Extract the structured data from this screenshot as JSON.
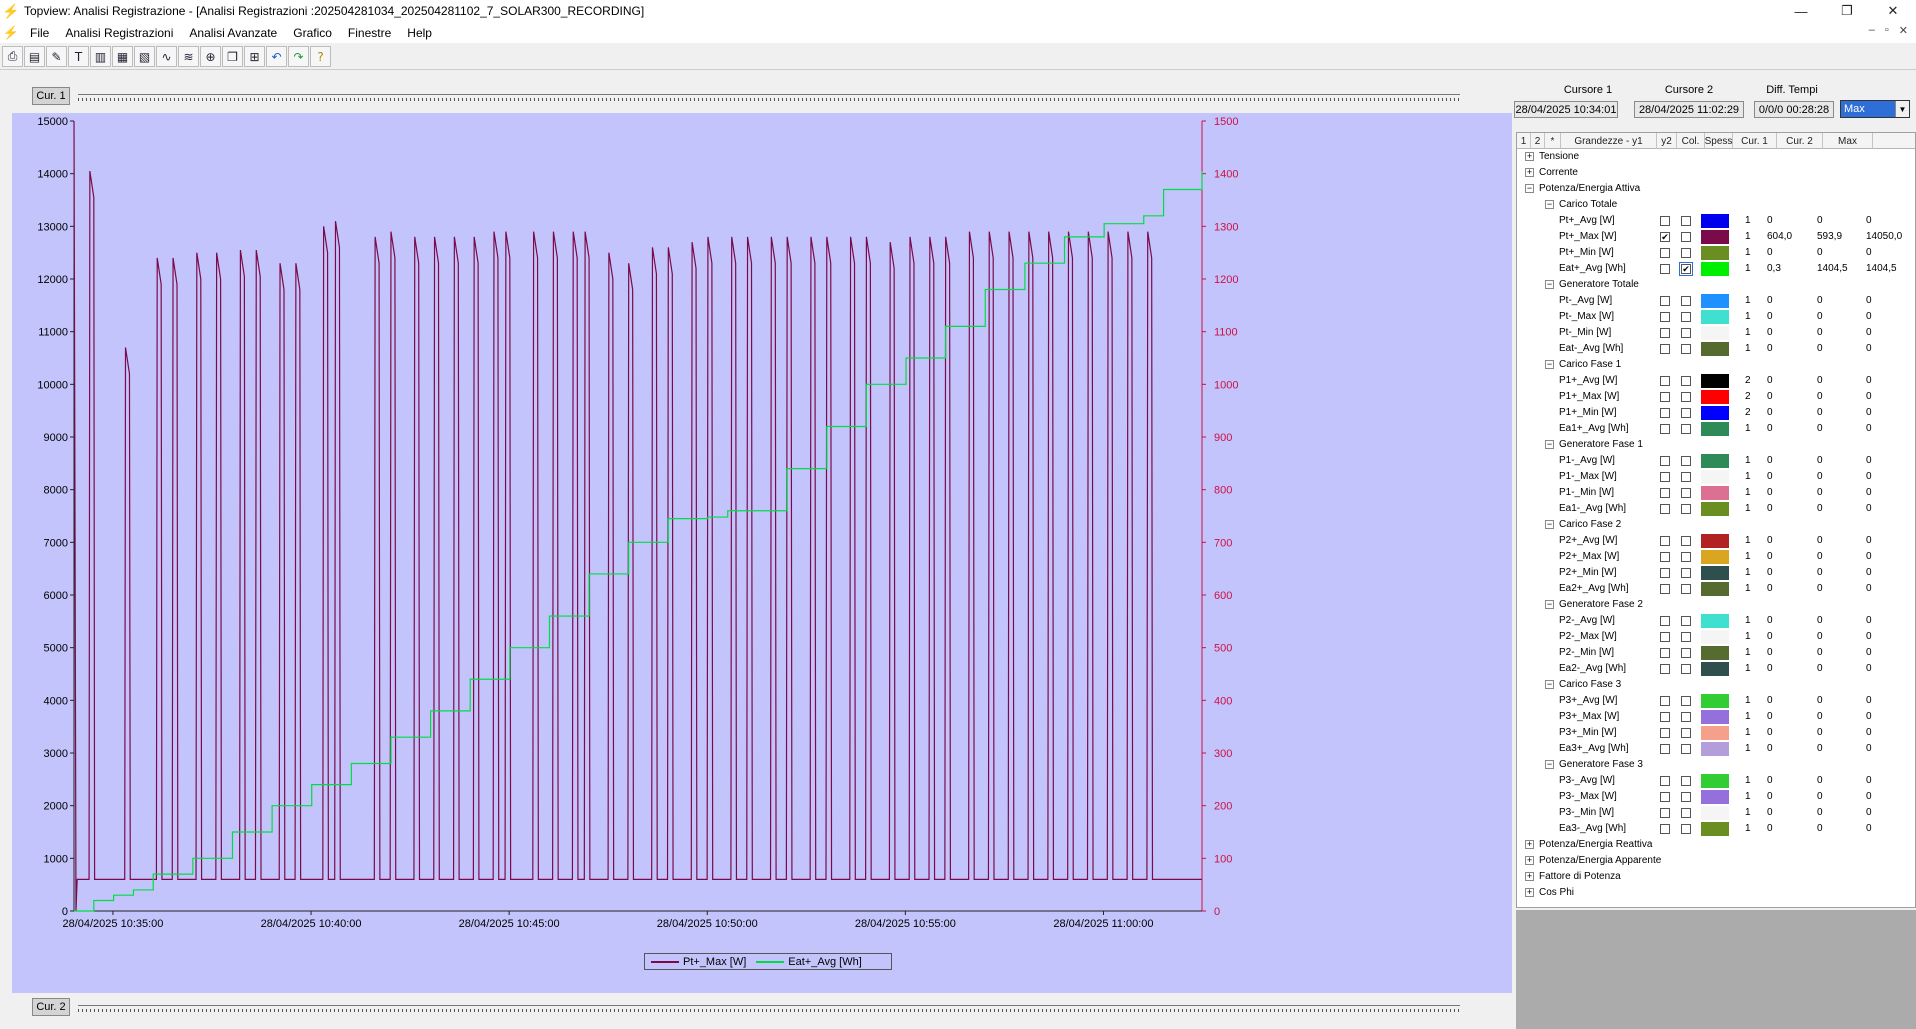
{
  "window": {
    "title": "Topview: Analisi Registrazione - [Analisi Registrazioni :202504281034_202504281102_7_SOLAR300_RECORDING]"
  },
  "menu": [
    "File",
    "Analisi Registrazioni",
    "Analisi Avanzate",
    "Grafico",
    "Finestre",
    "Help"
  ],
  "toolbar": {
    "icons": [
      "print-icon",
      "preview-icon",
      "settings-icon",
      "text-icon",
      "export1-icon",
      "export2-icon",
      "export3-icon",
      "wave1-icon",
      "wave2-icon",
      "zoom-icon",
      "copy-icon",
      "fit-icon",
      "undo-icon",
      "redo-icon",
      "help-icon"
    ]
  },
  "cursors": {
    "cur1_button": "Cur. 1",
    "cur2_button": "Cur. 2",
    "cursore1_label": "Cursore 1",
    "cursore1_value": "28/04/2025 10:34:01",
    "cursore2_label": "Cursore 2",
    "cursore2_value": "28/04/2025 11:02:29",
    "diff_label": "Diff. Tempi",
    "diff_value": "0/0/0 00:28:28",
    "mode_value": "Max"
  },
  "grid": {
    "headers": [
      "1",
      "2",
      "*",
      "Grandezze - y1",
      "y2",
      "Col.",
      "Spess",
      "Cur. 1",
      "Cur. 2",
      "Max"
    ],
    "rows": [
      {
        "t": "g1",
        "label": "Tensione",
        "exp": "+"
      },
      {
        "t": "g1",
        "label": "Corrente",
        "exp": "+"
      },
      {
        "t": "g1",
        "label": "Potenza/Energia Attiva",
        "exp": "−"
      },
      {
        "t": "g2",
        "label": "Carico Totale",
        "exp": "−"
      },
      {
        "t": "i",
        "label": "Pt+_Avg [W]",
        "y1": false,
        "y2": false,
        "color": "#0000ee",
        "spess": "1",
        "c1": "0",
        "c2": "0",
        "max": "0"
      },
      {
        "t": "i",
        "label": "Pt+_Max [W]",
        "y1": true,
        "y2": false,
        "color": "#7a0a4a",
        "spess": "1",
        "c1": "604,0",
        "c2": "593,9",
        "max": "14050,0"
      },
      {
        "t": "i",
        "label": "Pt+_Min [W]",
        "y1": false,
        "y2": false,
        "color": "#6b8e23",
        "spess": "1",
        "c1": "0",
        "c2": "0",
        "max": "0"
      },
      {
        "t": "i",
        "label": "Eat+_Avg [Wh]",
        "y1": false,
        "y2": true,
        "color": "#00ee00",
        "spess": "1",
        "c1": "0,3",
        "c2": "1404,5",
        "max": "1404,5",
        "hl": true
      },
      {
        "t": "g2",
        "label": "Generatore Totale",
        "exp": "−"
      },
      {
        "t": "i",
        "label": "Pt-_Avg [W]",
        "y1": false,
        "y2": false,
        "color": "#1e90ff",
        "spess": "1",
        "c1": "0",
        "c2": "0",
        "max": "0"
      },
      {
        "t": "i",
        "label": "Pt-_Max [W]",
        "y1": false,
        "y2": false,
        "color": "#40e0d0",
        "spess": "1",
        "c1": "0",
        "c2": "0",
        "max": "0"
      },
      {
        "t": "i",
        "label": "Pt-_Min [W]",
        "y1": false,
        "y2": false,
        "color": "#f5f5f5",
        "spess": "1",
        "c1": "0",
        "c2": "0",
        "max": "0"
      },
      {
        "t": "i",
        "label": "Eat-_Avg [Wh]",
        "y1": false,
        "y2": false,
        "color": "#556b2f",
        "spess": "1",
        "c1": "0",
        "c2": "0",
        "max": "0"
      },
      {
        "t": "g2",
        "label": "Carico Fase 1",
        "exp": "−"
      },
      {
        "t": "i",
        "label": "P1+_Avg [W]",
        "y1": false,
        "y2": false,
        "color": "#000000",
        "spess": "2",
        "c1": "0",
        "c2": "0",
        "max": "0"
      },
      {
        "t": "i",
        "label": "P1+_Max [W]",
        "y1": false,
        "y2": false,
        "color": "#ff0000",
        "spess": "2",
        "c1": "0",
        "c2": "0",
        "max": "0"
      },
      {
        "t": "i",
        "label": "P1+_Min [W]",
        "y1": false,
        "y2": false,
        "color": "#0000ff",
        "spess": "2",
        "c1": "0",
        "c2": "0",
        "max": "0"
      },
      {
        "t": "i",
        "label": "Ea1+_Avg [Wh]",
        "y1": false,
        "y2": false,
        "color": "#2e8b57",
        "spess": "1",
        "c1": "0",
        "c2": "0",
        "max": "0"
      },
      {
        "t": "g2",
        "label": "Generatore Fase 1",
        "exp": "−"
      },
      {
        "t": "i",
        "label": "P1-_Avg [W]",
        "y1": false,
        "y2": false,
        "color": "#2e8b57",
        "spess": "1",
        "c1": "0",
        "c2": "0",
        "max": "0"
      },
      {
        "t": "i",
        "label": "P1-_Max [W]",
        "y1": false,
        "y2": false,
        "color": "#f5f5f5",
        "spess": "1",
        "c1": "0",
        "c2": "0",
        "max": "0"
      },
      {
        "t": "i",
        "label": "P1-_Min [W]",
        "y1": false,
        "y2": false,
        "color": "#db7093",
        "spess": "1",
        "c1": "0",
        "c2": "0",
        "max": "0"
      },
      {
        "t": "i",
        "label": "Ea1-_Avg [Wh]",
        "y1": false,
        "y2": false,
        "color": "#6b8e23",
        "spess": "1",
        "c1": "0",
        "c2": "0",
        "max": "0"
      },
      {
        "t": "g2",
        "label": "Carico Fase 2",
        "exp": "−"
      },
      {
        "t": "i",
        "label": "P2+_Avg [W]",
        "y1": false,
        "y2": false,
        "color": "#b22222",
        "spess": "1",
        "c1": "0",
        "c2": "0",
        "max": "0"
      },
      {
        "t": "i",
        "label": "P2+_Max [W]",
        "y1": false,
        "y2": false,
        "color": "#daa520",
        "spess": "1",
        "c1": "0",
        "c2": "0",
        "max": "0"
      },
      {
        "t": "i",
        "label": "P2+_Min [W]",
        "y1": false,
        "y2": false,
        "color": "#2f4f4f",
        "spess": "1",
        "c1": "0",
        "c2": "0",
        "max": "0"
      },
      {
        "t": "i",
        "label": "Ea2+_Avg [Wh]",
        "y1": false,
        "y2": false,
        "color": "#556b2f",
        "spess": "1",
        "c1": "0",
        "c2": "0",
        "max": "0"
      },
      {
        "t": "g2",
        "label": "Generatore Fase 2",
        "exp": "−"
      },
      {
        "t": "i",
        "label": "P2-_Avg [W]",
        "y1": false,
        "y2": false,
        "color": "#40e0d0",
        "spess": "1",
        "c1": "0",
        "c2": "0",
        "max": "0"
      },
      {
        "t": "i",
        "label": "P2-_Max [W]",
        "y1": false,
        "y2": false,
        "color": "#f5f5f5",
        "spess": "1",
        "c1": "0",
        "c2": "0",
        "max": "0"
      },
      {
        "t": "i",
        "label": "P2-_Min [W]",
        "y1": false,
        "y2": false,
        "color": "#556b2f",
        "spess": "1",
        "c1": "0",
        "c2": "0",
        "max": "0"
      },
      {
        "t": "i",
        "label": "Ea2-_Avg [Wh]",
        "y1": false,
        "y2": false,
        "color": "#2f4f4f",
        "spess": "1",
        "c1": "0",
        "c2": "0",
        "max": "0"
      },
      {
        "t": "g2",
        "label": "Carico Fase 3",
        "exp": "−"
      },
      {
        "t": "i",
        "label": "P3+_Avg [W]",
        "y1": false,
        "y2": false,
        "color": "#32cd32",
        "spess": "1",
        "c1": "0",
        "c2": "0",
        "max": "0"
      },
      {
        "t": "i",
        "label": "P3+_Max [W]",
        "y1": false,
        "y2": false,
        "color": "#9370db",
        "spess": "1",
        "c1": "0",
        "c2": "0",
        "max": "0"
      },
      {
        "t": "i",
        "label": "P3+_Min [W]",
        "y1": false,
        "y2": false,
        "color": "#f4a08a",
        "spess": "1",
        "c1": "0",
        "c2": "0",
        "max": "0"
      },
      {
        "t": "i",
        "label": "Ea3+_Avg [Wh]",
        "y1": false,
        "y2": false,
        "color": "#b39ddb",
        "spess": "1",
        "c1": "0",
        "c2": "0",
        "max": "0"
      },
      {
        "t": "g2",
        "label": "Generatore Fase 3",
        "exp": "−"
      },
      {
        "t": "i",
        "label": "P3-_Avg [W]",
        "y1": false,
        "y2": false,
        "color": "#32cd32",
        "spess": "1",
        "c1": "0",
        "c2": "0",
        "max": "0"
      },
      {
        "t": "i",
        "label": "P3-_Max [W]",
        "y1": false,
        "y2": false,
        "color": "#9370db",
        "spess": "1",
        "c1": "0",
        "c2": "0",
        "max": "0"
      },
      {
        "t": "i",
        "label": "P3-_Min [W]",
        "y1": false,
        "y2": false,
        "color": "#f5f5f5",
        "spess": "1",
        "c1": "0",
        "c2": "0",
        "max": "0"
      },
      {
        "t": "i",
        "label": "Ea3-_Avg [Wh]",
        "y1": false,
        "y2": false,
        "color": "#6b8e23",
        "spess": "1",
        "c1": "0",
        "c2": "0",
        "max": "0"
      },
      {
        "t": "g1",
        "label": "Potenza/Energia Reattiva",
        "exp": "+"
      },
      {
        "t": "g1",
        "label": "Potenza/Energia Apparente",
        "exp": "+"
      },
      {
        "t": "g1",
        "label": "Fattore di Potenza",
        "exp": "+"
      },
      {
        "t": "g1",
        "label": "Cos Phi",
        "exp": "+"
      }
    ]
  },
  "chart_data": {
    "type": "line",
    "background": "#c4c4fc",
    "x_range": [
      "28/04/2025 10:34:01",
      "28/04/2025 11:02:29"
    ],
    "x_ticks": [
      "28/04/2025 10:35:00",
      "28/04/2025 10:40:00",
      "28/04/2025 10:45:00",
      "28/04/2025 10:50:00",
      "28/04/2025 10:55:00",
      "28/04/2025 11:00:00"
    ],
    "y1_range": [
      0,
      15000
    ],
    "y1_ticks": [
      "0",
      "1000",
      "2000",
      "3000",
      "4000",
      "5000",
      "6000",
      "7000",
      "8000",
      "9000",
      "10000",
      "11000",
      "12000",
      "13000",
      "14000",
      "15000"
    ],
    "y2_range": [
      0,
      1500
    ],
    "y2_ticks": [
      "0",
      "100",
      "200",
      "300",
      "400",
      "500",
      "600",
      "700",
      "800",
      "900",
      "1000",
      "1100",
      "1200",
      "1300",
      "1400",
      "1500"
    ],
    "y2_tick_color": "#cc1144",
    "series": [
      {
        "name": "Pt+_Max [W]",
        "axis": "y1",
        "color": "#7a0a4a",
        "baseline": 600,
        "spikes_at_min": [
          0.4,
          1.3,
          2.1,
          2.5,
          3.1,
          3.6,
          4.2,
          4.6,
          5.2,
          5.6,
          6.3,
          6.6,
          7.6,
          8.0,
          8.6,
          9.1,
          9.6,
          10.1,
          10.6,
          10.9,
          11.6,
          12.1,
          12.6,
          12.9,
          13.5,
          14.0,
          14.6,
          15.0,
          15.6,
          16.0,
          16.6,
          17.0,
          17.6,
          18.0,
          18.6,
          19.0,
          19.6,
          20.0,
          20.6,
          21.1,
          21.6,
          22.0,
          22.6,
          23.1,
          23.6,
          24.1,
          24.6,
          25.1,
          25.6,
          26.1,
          26.6,
          27.1
        ],
        "spike_peaks": [
          14050,
          10700,
          12400,
          12400,
          12500,
          12500,
          12550,
          12550,
          12300,
          12300,
          13000,
          13100,
          12800,
          12900,
          12800,
          12800,
          12800,
          12800,
          12900,
          12900,
          12900,
          12900,
          12900,
          12900,
          12500,
          12300,
          12600,
          12600,
          12700,
          12800,
          12800,
          12800,
          12800,
          12800,
          12800,
          12800,
          12800,
          12800,
          12700,
          12800,
          12800,
          12800,
          12900,
          12900,
          12900,
          12900,
          12900,
          12900,
          12900,
          12900,
          12900,
          12900
        ]
      },
      {
        "name": "Eat+_Avg [Wh]",
        "axis": "y2",
        "color": "#00dd44",
        "x_min": [
          0,
          0.5,
          1,
          1.5,
          2,
          3,
          4,
          5,
          6,
          7,
          8,
          9,
          10,
          11,
          12,
          13,
          14,
          15,
          16,
          16.5,
          18,
          19,
          20,
          21,
          22,
          23,
          24,
          25,
          26,
          27,
          27.5,
          28.47
        ],
        "values": [
          0,
          20,
          30,
          40,
          70,
          100,
          150,
          200,
          240,
          280,
          330,
          380,
          440,
          500,
          560,
          640,
          700,
          745,
          748,
          760,
          840,
          920,
          1000,
          1050,
          1110,
          1180,
          1230,
          1280,
          1305,
          1320,
          1370,
          1404.5
        ]
      }
    ]
  }
}
